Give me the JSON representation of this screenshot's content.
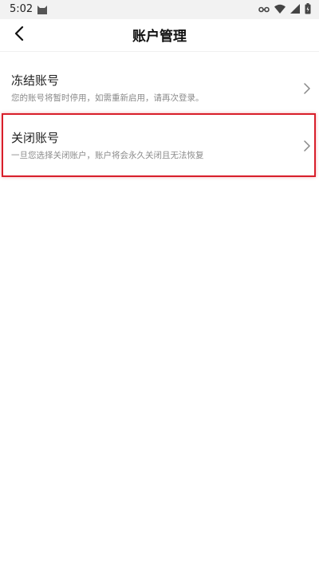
{
  "status_bar": {
    "time": "5:02",
    "icons": [
      "cat-app-icon",
      "vpn-key-icon",
      "wifi-icon",
      "signal-icon",
      "battery-charging-icon"
    ]
  },
  "nav": {
    "title": "账户管理",
    "back_icon": "chevron-left-icon"
  },
  "items": [
    {
      "title": "冻结账号",
      "description": "您的账号将暂时停用，如需重新启用，请再次登录。"
    },
    {
      "title": "关闭账号",
      "description": "一旦您选择关闭账户，账户将会永久关闭且无法恢复"
    }
  ],
  "colors": {
    "highlight": "#d81e2a",
    "status_bar_bg": "#f2f2f2",
    "secondary_text": "#8a8a8a"
  }
}
